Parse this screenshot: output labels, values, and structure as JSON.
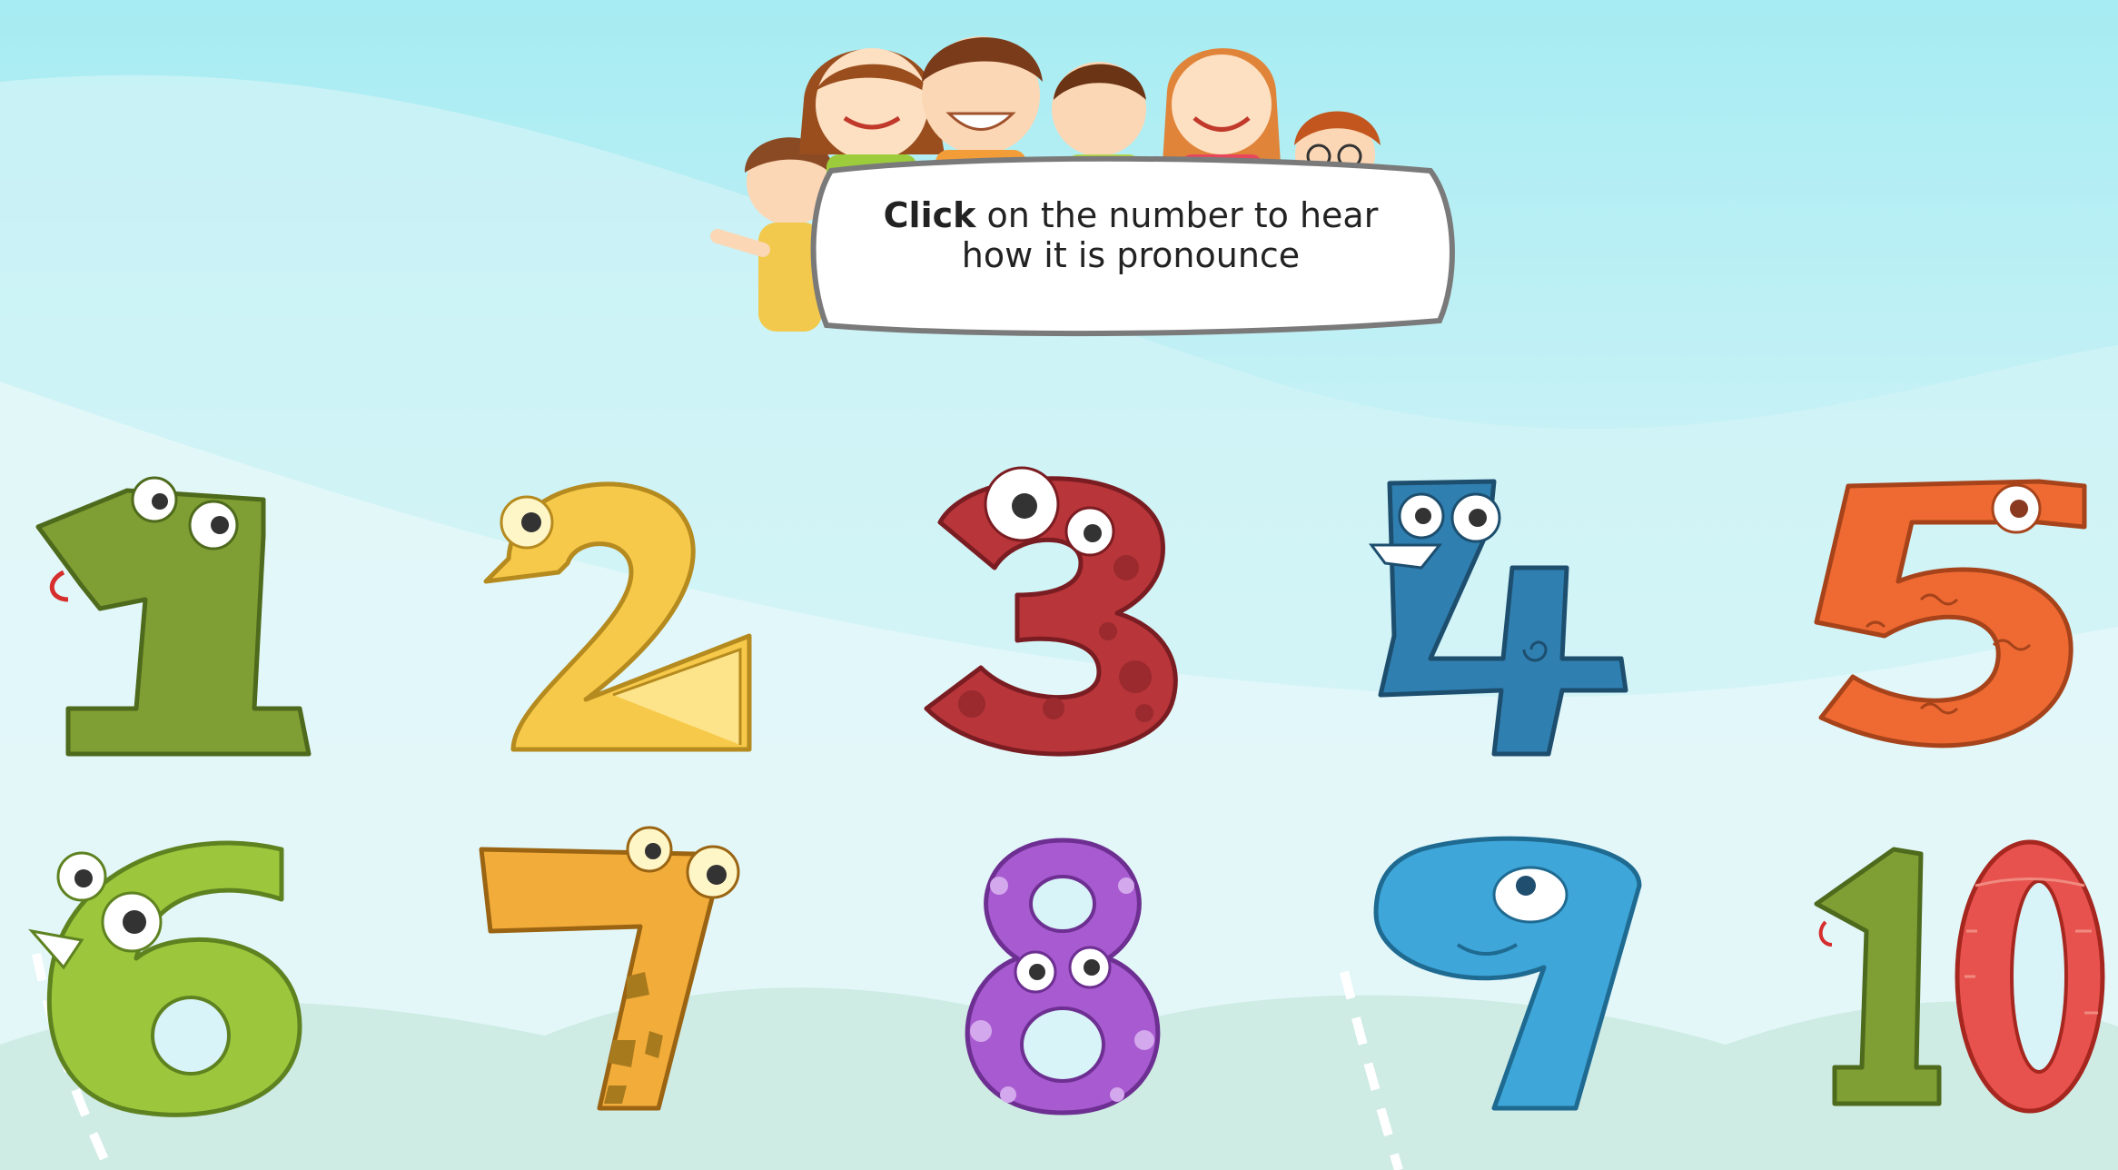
{
  "instruction": {
    "bold": "Click",
    "line1_rest": " on the number to hear",
    "line2": "how it is pronounce"
  },
  "numbers": [
    {
      "label": "1",
      "color": "#7f9f34"
    },
    {
      "label": "2",
      "color": "#f7c94a"
    },
    {
      "label": "3",
      "color": "#b8353a"
    },
    {
      "label": "4",
      "color": "#2f7fb0"
    },
    {
      "label": "5",
      "color": "#ee6a32"
    },
    {
      "label": "6",
      "color": "#9cc73c"
    },
    {
      "label": "7",
      "color": "#f2ac3a"
    },
    {
      "label": "8",
      "color": "#a85ad0"
    },
    {
      "label": "9",
      "color": "#3ea6d8"
    },
    {
      "label": "10",
      "color": "#e8524e"
    }
  ]
}
